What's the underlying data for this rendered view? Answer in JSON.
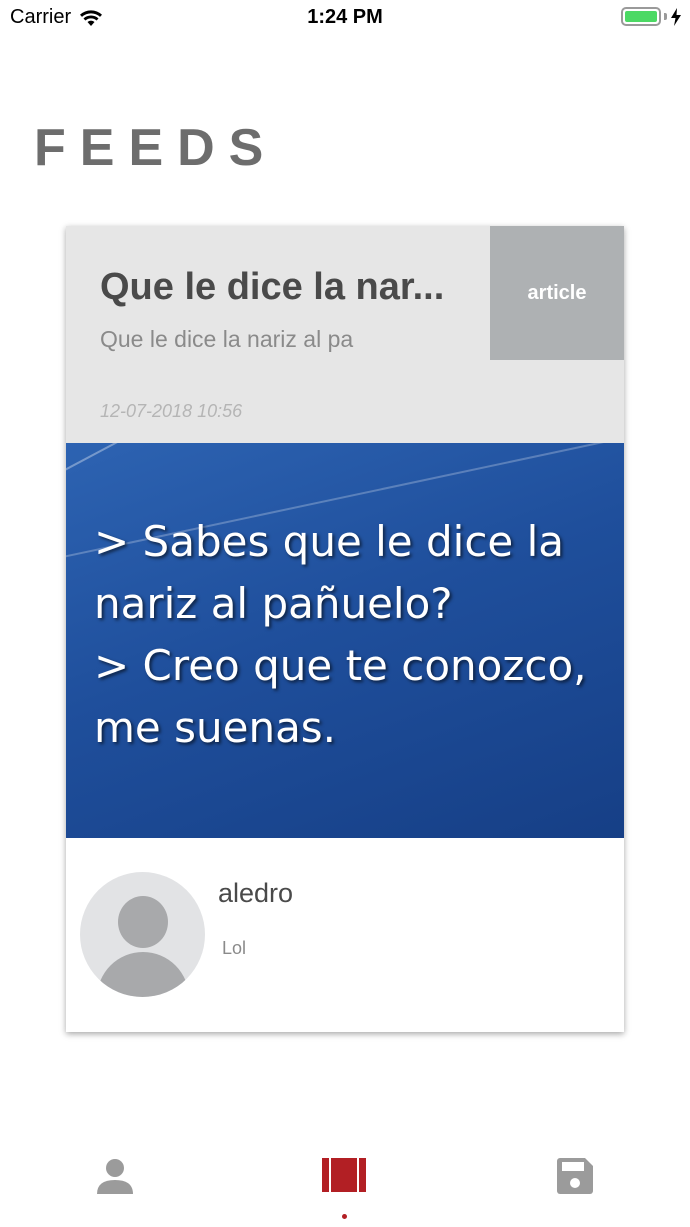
{
  "status_bar": {
    "carrier": "Carrier",
    "time": "1:24 PM",
    "battery_level": 1.0
  },
  "page": {
    "title": "FEEDS"
  },
  "feed_card": {
    "title": "Que le dice la nar...",
    "subtitle": "Que le dice la nariz al pa",
    "date": "12-07-2018 10:56",
    "type_badge": "article",
    "image_text": [
      "> Sabes que le dice la",
      "nariz al pañuelo?",
      "> Creo que te conozco,",
      "me suenas."
    ],
    "author": "aledro",
    "comment": "Lol"
  },
  "tab_bar": {
    "tabs": [
      {
        "icon": "person-icon"
      },
      {
        "icon": "feeds-icon",
        "active": true
      },
      {
        "icon": "save-disk-icon"
      }
    ],
    "active_color": "#b21f24",
    "inactive_color": "#9b9b9b"
  }
}
